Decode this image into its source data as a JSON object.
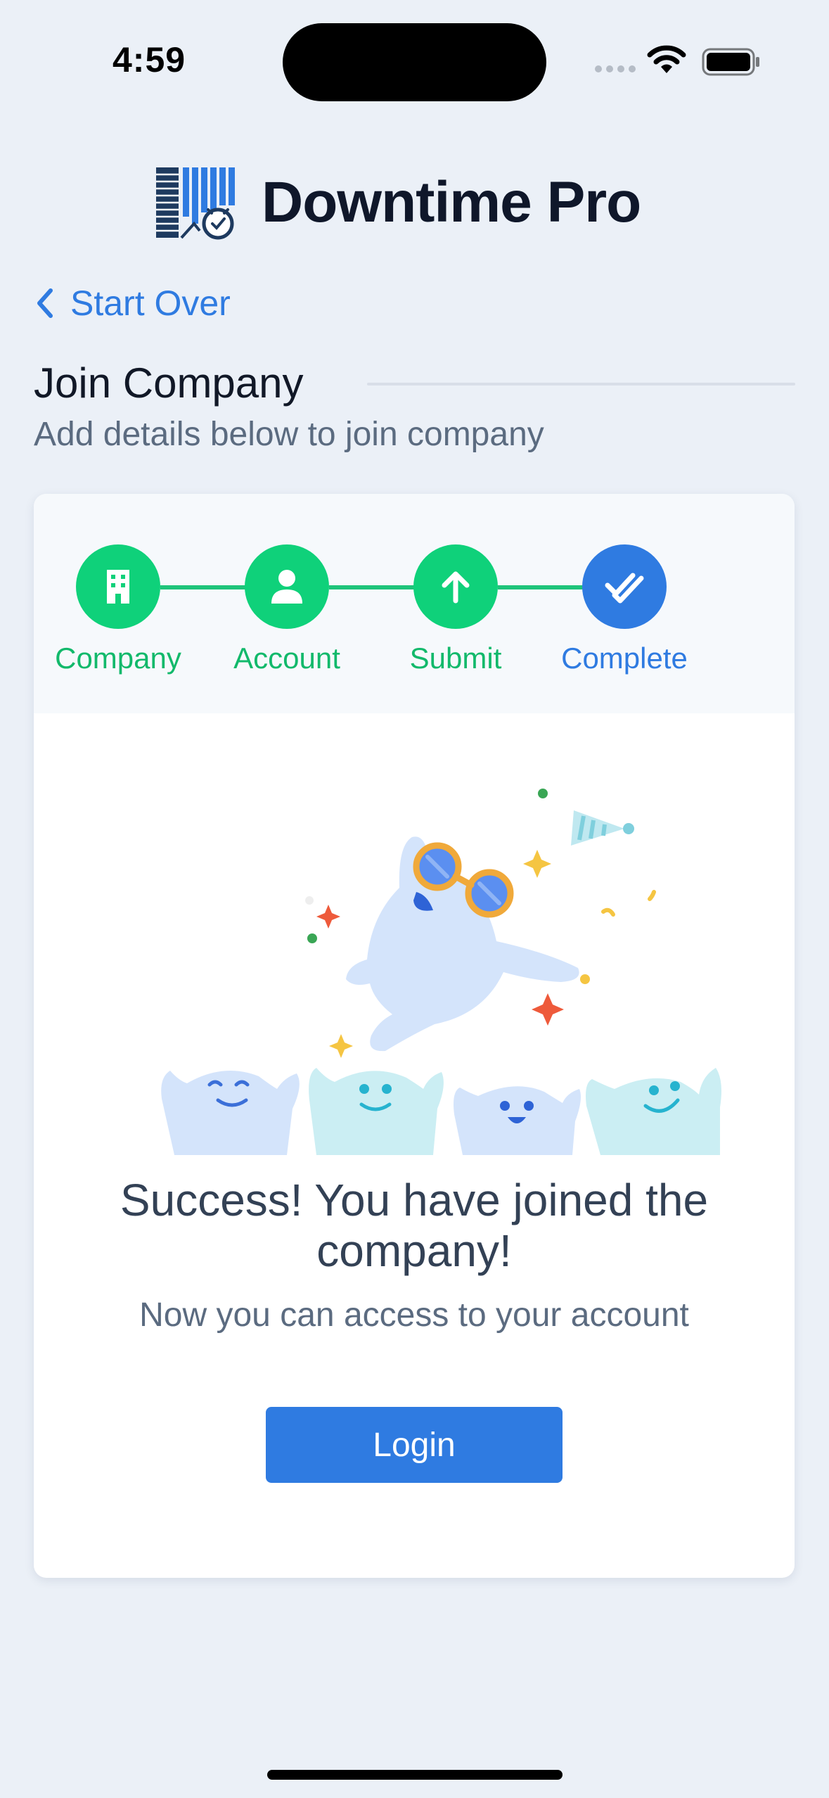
{
  "status_bar": {
    "time": "4:59"
  },
  "brand": {
    "title": "Downtime Pro"
  },
  "nav": {
    "back_label": "Start Over"
  },
  "section": {
    "title": "Join Company",
    "subtitle": "Add details below to join company"
  },
  "steps": [
    {
      "label": "Company",
      "icon": "building-icon",
      "state": "done"
    },
    {
      "label": "Account",
      "icon": "user-icon",
      "state": "done"
    },
    {
      "label": "Submit",
      "icon": "arrow-up-icon",
      "state": "done"
    },
    {
      "label": "Complete",
      "icon": "double-check-icon",
      "state": "active"
    }
  ],
  "success": {
    "title": "Success! You have joined the company!",
    "subtitle": "Now you can access to your account",
    "login_label": "Login"
  },
  "colors": {
    "background": "#ebf0f7",
    "accent": "#2f7be1",
    "done": "#0fd17a",
    "done_text": "#12b96b"
  }
}
